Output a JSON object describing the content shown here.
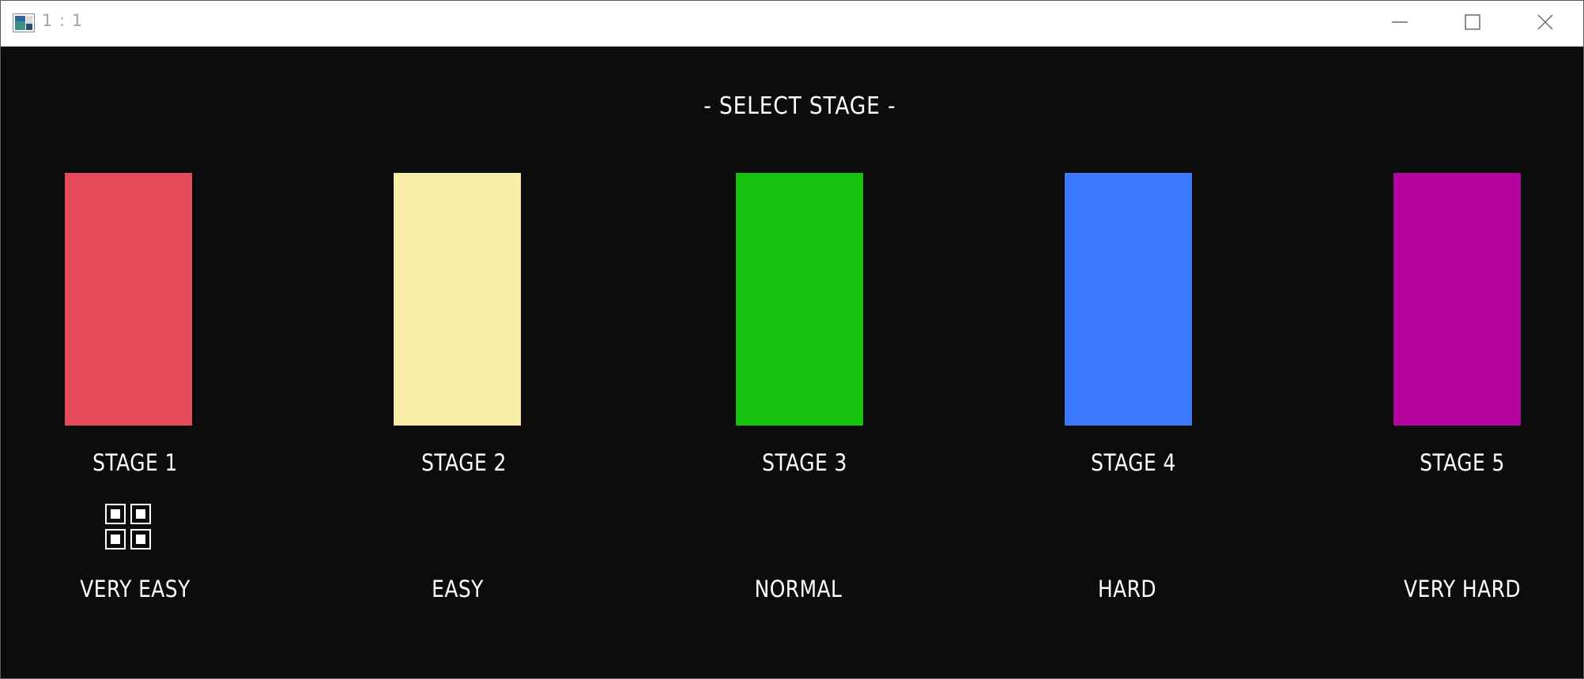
{
  "window": {
    "title": "1 : 1"
  },
  "heading": "- SELECT STAGE -",
  "stages": [
    {
      "label": "STAGE 1",
      "difficulty": "VERY EASY",
      "color": "#e54b58"
    },
    {
      "label": "STAGE 2",
      "difficulty": "EASY",
      "color": "#f8eea8"
    },
    {
      "label": "STAGE 3",
      "difficulty": "NORMAL",
      "color": "#16c310"
    },
    {
      "label": "STAGE 4",
      "difficulty": "HARD",
      "color": "#3c78fe"
    },
    {
      "label": "STAGE 5",
      "difficulty": "VERY HARD",
      "color": "#b4039f"
    }
  ],
  "selected_stage_index": 0,
  "icons": {
    "app": "app-window-icon",
    "minimize": "minimize-icon",
    "maximize": "maximize-icon",
    "close": "close-icon",
    "selection_cursor": "selection-cursor-icon"
  }
}
